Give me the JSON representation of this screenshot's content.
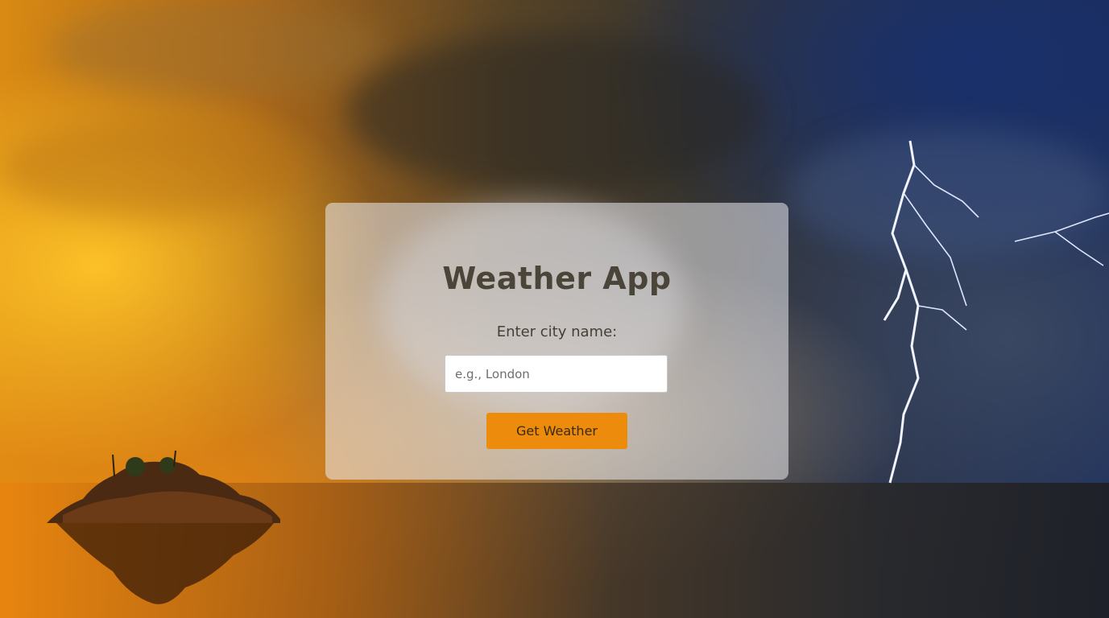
{
  "app": {
    "title": "Weather App"
  },
  "form": {
    "label": "Enter city name:",
    "input_placeholder": "e.g., London",
    "input_value": "",
    "submit_label": "Get Weather"
  },
  "colors": {
    "accent_button": "#ec8b0c",
    "title_text": "#4b4438",
    "card_background": "rgba(235,235,240,0.55)"
  }
}
